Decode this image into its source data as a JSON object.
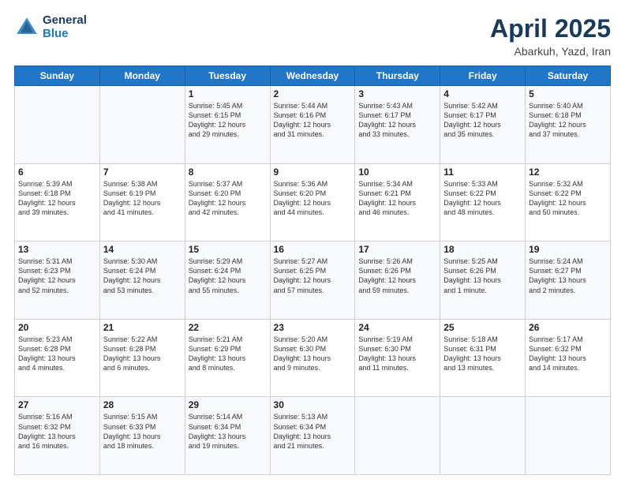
{
  "header": {
    "logo_line1": "General",
    "logo_line2": "Blue",
    "title": "April 2025",
    "subtitle": "Abarkuh, Yazd, Iran"
  },
  "days_of_week": [
    "Sunday",
    "Monday",
    "Tuesday",
    "Wednesday",
    "Thursday",
    "Friday",
    "Saturday"
  ],
  "weeks": [
    [
      {
        "day": "",
        "info": ""
      },
      {
        "day": "",
        "info": ""
      },
      {
        "day": "1",
        "info": "Sunrise: 5:45 AM\nSunset: 6:15 PM\nDaylight: 12 hours\nand 29 minutes."
      },
      {
        "day": "2",
        "info": "Sunrise: 5:44 AM\nSunset: 6:16 PM\nDaylight: 12 hours\nand 31 minutes."
      },
      {
        "day": "3",
        "info": "Sunrise: 5:43 AM\nSunset: 6:17 PM\nDaylight: 12 hours\nand 33 minutes."
      },
      {
        "day": "4",
        "info": "Sunrise: 5:42 AM\nSunset: 6:17 PM\nDaylight: 12 hours\nand 35 minutes."
      },
      {
        "day": "5",
        "info": "Sunrise: 5:40 AM\nSunset: 6:18 PM\nDaylight: 12 hours\nand 37 minutes."
      }
    ],
    [
      {
        "day": "6",
        "info": "Sunrise: 5:39 AM\nSunset: 6:18 PM\nDaylight: 12 hours\nand 39 minutes."
      },
      {
        "day": "7",
        "info": "Sunrise: 5:38 AM\nSunset: 6:19 PM\nDaylight: 12 hours\nand 41 minutes."
      },
      {
        "day": "8",
        "info": "Sunrise: 5:37 AM\nSunset: 6:20 PM\nDaylight: 12 hours\nand 42 minutes."
      },
      {
        "day": "9",
        "info": "Sunrise: 5:36 AM\nSunset: 6:20 PM\nDaylight: 12 hours\nand 44 minutes."
      },
      {
        "day": "10",
        "info": "Sunrise: 5:34 AM\nSunset: 6:21 PM\nDaylight: 12 hours\nand 46 minutes."
      },
      {
        "day": "11",
        "info": "Sunrise: 5:33 AM\nSunset: 6:22 PM\nDaylight: 12 hours\nand 48 minutes."
      },
      {
        "day": "12",
        "info": "Sunrise: 5:32 AM\nSunset: 6:22 PM\nDaylight: 12 hours\nand 50 minutes."
      }
    ],
    [
      {
        "day": "13",
        "info": "Sunrise: 5:31 AM\nSunset: 6:23 PM\nDaylight: 12 hours\nand 52 minutes."
      },
      {
        "day": "14",
        "info": "Sunrise: 5:30 AM\nSunset: 6:24 PM\nDaylight: 12 hours\nand 53 minutes."
      },
      {
        "day": "15",
        "info": "Sunrise: 5:29 AM\nSunset: 6:24 PM\nDaylight: 12 hours\nand 55 minutes."
      },
      {
        "day": "16",
        "info": "Sunrise: 5:27 AM\nSunset: 6:25 PM\nDaylight: 12 hours\nand 57 minutes."
      },
      {
        "day": "17",
        "info": "Sunrise: 5:26 AM\nSunset: 6:26 PM\nDaylight: 12 hours\nand 59 minutes."
      },
      {
        "day": "18",
        "info": "Sunrise: 5:25 AM\nSunset: 6:26 PM\nDaylight: 13 hours\nand 1 minute."
      },
      {
        "day": "19",
        "info": "Sunrise: 5:24 AM\nSunset: 6:27 PM\nDaylight: 13 hours\nand 2 minutes."
      }
    ],
    [
      {
        "day": "20",
        "info": "Sunrise: 5:23 AM\nSunset: 6:28 PM\nDaylight: 13 hours\nand 4 minutes."
      },
      {
        "day": "21",
        "info": "Sunrise: 5:22 AM\nSunset: 6:28 PM\nDaylight: 13 hours\nand 6 minutes."
      },
      {
        "day": "22",
        "info": "Sunrise: 5:21 AM\nSunset: 6:29 PM\nDaylight: 13 hours\nand 8 minutes."
      },
      {
        "day": "23",
        "info": "Sunrise: 5:20 AM\nSunset: 6:30 PM\nDaylight: 13 hours\nand 9 minutes."
      },
      {
        "day": "24",
        "info": "Sunrise: 5:19 AM\nSunset: 6:30 PM\nDaylight: 13 hours\nand 11 minutes."
      },
      {
        "day": "25",
        "info": "Sunrise: 5:18 AM\nSunset: 6:31 PM\nDaylight: 13 hours\nand 13 minutes."
      },
      {
        "day": "26",
        "info": "Sunrise: 5:17 AM\nSunset: 6:32 PM\nDaylight: 13 hours\nand 14 minutes."
      }
    ],
    [
      {
        "day": "27",
        "info": "Sunrise: 5:16 AM\nSunset: 6:32 PM\nDaylight: 13 hours\nand 16 minutes."
      },
      {
        "day": "28",
        "info": "Sunrise: 5:15 AM\nSunset: 6:33 PM\nDaylight: 13 hours\nand 18 minutes."
      },
      {
        "day": "29",
        "info": "Sunrise: 5:14 AM\nSunset: 6:34 PM\nDaylight: 13 hours\nand 19 minutes."
      },
      {
        "day": "30",
        "info": "Sunrise: 5:13 AM\nSunset: 6:34 PM\nDaylight: 13 hours\nand 21 minutes."
      },
      {
        "day": "",
        "info": ""
      },
      {
        "day": "",
        "info": ""
      },
      {
        "day": "",
        "info": ""
      }
    ]
  ]
}
